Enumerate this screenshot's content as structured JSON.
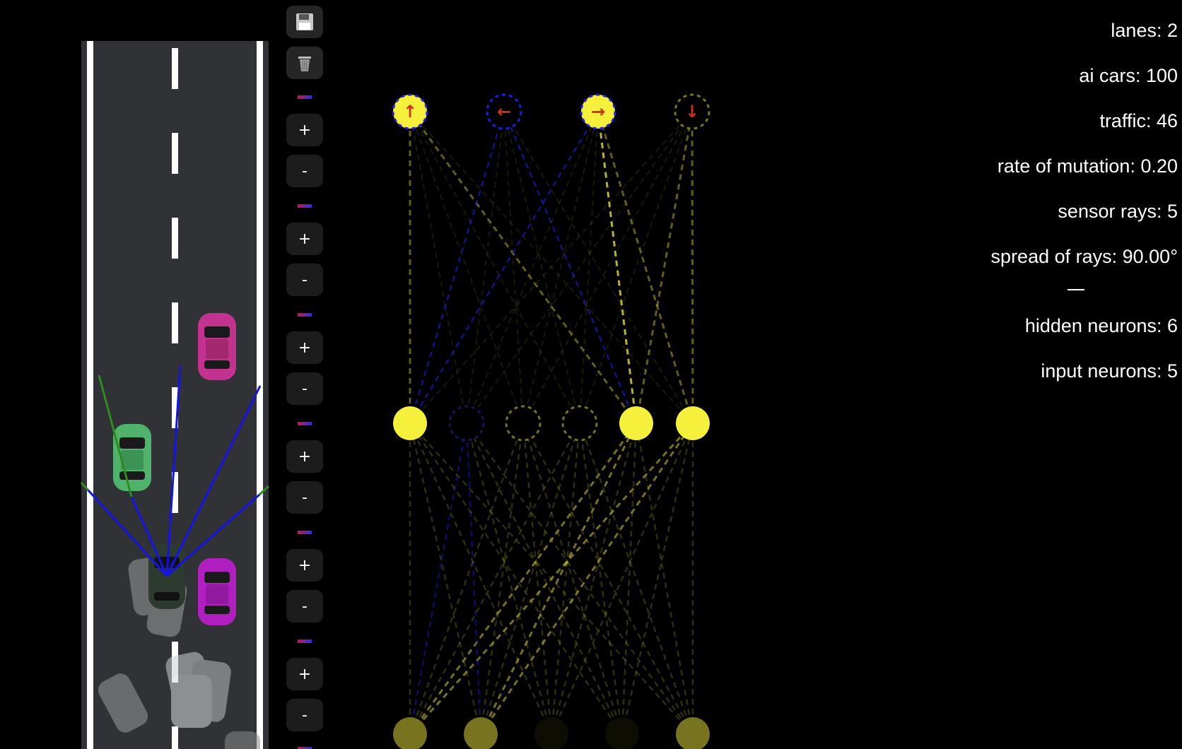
{
  "stats": {
    "lanes": "lanes: 2",
    "ai_cars": "ai cars: 100",
    "traffic": "traffic: 46",
    "mutation": "rate of mutation: 0.20",
    "sensor_rays": "sensor rays: 5",
    "spread": "spread of rays: 90.00°",
    "hidden_neurons": "hidden neurons: 6",
    "input_neurons": "input neurons: 5"
  },
  "controls": {
    "save_icon": "floppy-disk-icon",
    "delete_icon": "trash-icon",
    "plus_label": "+",
    "minus_label": "-"
  },
  "network": {
    "outputs": [
      {
        "symbol": "↑",
        "active": true
      },
      {
        "symbol": "←",
        "active": false
      },
      {
        "symbol": "→",
        "active": true
      },
      {
        "symbol": "↓",
        "active": false
      }
    ],
    "hidden_active": [
      true,
      false,
      false,
      false,
      true,
      true
    ],
    "input_levels": [
      0.55,
      0.55,
      0,
      0.05,
      0.55
    ]
  },
  "colors": {
    "neuron_active": "#f5f03c",
    "neuron_dim": "#77731e",
    "arrow": "#d03010",
    "negative_weight": "#1f1fd8",
    "positive_weight": "#d8d03a",
    "road": "#303236",
    "sensor_ray": "#1414e6",
    "sensor_ray_hit": "#2e8b1e"
  }
}
